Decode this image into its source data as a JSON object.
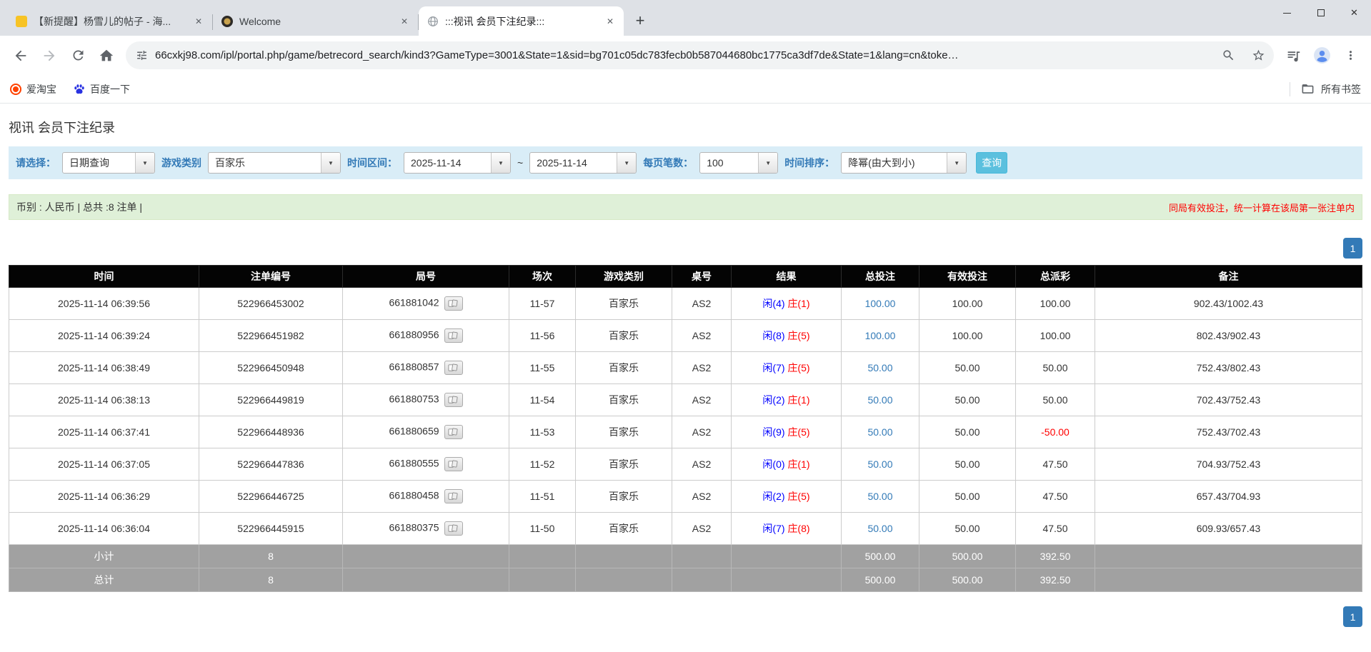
{
  "icons": {
    "dropdown_arrow": "▼",
    "close": "✕",
    "plus": "+"
  },
  "colors": {
    "player_blue": "#0000ff",
    "banker_red": "#ff0000",
    "bet_link_blue": "#337ab7",
    "search_button": "#5bc0de",
    "pagination_blue": "#337ab7",
    "filter_bar_bg": "#d9edf7",
    "summary_bar_bg": "#dff0d8",
    "table_header_bg": "#040404",
    "summary_row_bg": "#a1a1a1"
  },
  "browser": {
    "tabs": [
      {
        "title": "【新提醒】杨雪儿的帖子 - 海..."
      },
      {
        "title": "Welcome"
      },
      {
        "title": ":::视讯 会员下注纪录:::"
      }
    ],
    "url": "66cxkj98.com/ipl/portal.php/game/betrecord_search/kind3?GameType=3001&State=1&sid=bg701c05dc783fecb0b587044680bc1775ca3df7de&State=1&lang=cn&toke…",
    "bookmarks": {
      "items": [
        {
          "label": "爱淘宝"
        },
        {
          "label": "百度一下"
        }
      ],
      "all_bookmarks_label": "所有书签"
    }
  },
  "page": {
    "title": "视讯 会员下注纪录",
    "filter": {
      "select_label": "请选择：",
      "select_value": "日期查询",
      "game_type_label": "游戏类别",
      "game_type_value": "百家乐",
      "range_label": "时间区间：",
      "date_from": "2025-11-14",
      "range_separator": "~",
      "date_to": "2025-11-14",
      "page_size_label": "每页笔数：",
      "page_size_value": "100",
      "sort_label": "时间排序：",
      "sort_value": "降幂(由大到小)",
      "search_button_label": "查询"
    },
    "summary": {
      "currency_info": "币别 : 人民币 | 总共 :8 注单 |",
      "notice": "同局有效投注，统一计算在该局第一张注单内"
    },
    "pagination": {
      "page": "1"
    },
    "table": {
      "headers": [
        "时间",
        "注单编号",
        "局号",
        "场次",
        "游戏类别",
        "桌号",
        "结果",
        "总投注",
        "有效投注",
        "总派彩",
        "备注"
      ],
      "rows": [
        {
          "time": "2025-11-14 06:39:56",
          "bet_id": "522966453002",
          "round_no": "661881042",
          "session": "11-57",
          "game_type": "百家乐",
          "table_no": "AS2",
          "result_player": "闲(4)",
          "result_banker": "庄(1)",
          "total_bet": "100.00",
          "valid_bet": "100.00",
          "payout": "100.00",
          "payout_negative": false,
          "note": "902.43/1002.43"
        },
        {
          "time": "2025-11-14 06:39:24",
          "bet_id": "522966451982",
          "round_no": "661880956",
          "session": "11-56",
          "game_type": "百家乐",
          "table_no": "AS2",
          "result_player": "闲(8)",
          "result_banker": "庄(5)",
          "total_bet": "100.00",
          "valid_bet": "100.00",
          "payout": "100.00",
          "payout_negative": false,
          "note": "802.43/902.43"
        },
        {
          "time": "2025-11-14 06:38:49",
          "bet_id": "522966450948",
          "round_no": "661880857",
          "session": "11-55",
          "game_type": "百家乐",
          "table_no": "AS2",
          "result_player": "闲(7)",
          "result_banker": "庄(5)",
          "total_bet": "50.00",
          "valid_bet": "50.00",
          "payout": "50.00",
          "payout_negative": false,
          "note": "752.43/802.43"
        },
        {
          "time": "2025-11-14 06:38:13",
          "bet_id": "522966449819",
          "round_no": "661880753",
          "session": "11-54",
          "game_type": "百家乐",
          "table_no": "AS2",
          "result_player": "闲(2)",
          "result_banker": "庄(1)",
          "total_bet": "50.00",
          "valid_bet": "50.00",
          "payout": "50.00",
          "payout_negative": false,
          "note": "702.43/752.43"
        },
        {
          "time": "2025-11-14 06:37:41",
          "bet_id": "522966448936",
          "round_no": "661880659",
          "session": "11-53",
          "game_type": "百家乐",
          "table_no": "AS2",
          "result_player": "闲(9)",
          "result_banker": "庄(5)",
          "total_bet": "50.00",
          "valid_bet": "50.00",
          "payout": "-50.00",
          "payout_negative": true,
          "note": "752.43/702.43"
        },
        {
          "time": "2025-11-14 06:37:05",
          "bet_id": "522966447836",
          "round_no": "661880555",
          "session": "11-52",
          "game_type": "百家乐",
          "table_no": "AS2",
          "result_player": "闲(0)",
          "result_banker": "庄(1)",
          "total_bet": "50.00",
          "valid_bet": "50.00",
          "payout": "47.50",
          "payout_negative": false,
          "note": "704.93/752.43"
        },
        {
          "time": "2025-11-14 06:36:29",
          "bet_id": "522966446725",
          "round_no": "661880458",
          "session": "11-51",
          "game_type": "百家乐",
          "table_no": "AS2",
          "result_player": "闲(2)",
          "result_banker": "庄(5)",
          "total_bet": "50.00",
          "valid_bet": "50.00",
          "payout": "47.50",
          "payout_negative": false,
          "note": "657.43/704.93"
        },
        {
          "time": "2025-11-14 06:36:04",
          "bet_id": "522966445915",
          "round_no": "661880375",
          "session": "11-50",
          "game_type": "百家乐",
          "table_no": "AS2",
          "result_player": "闲(7)",
          "result_banker": "庄(8)",
          "total_bet": "50.00",
          "valid_bet": "50.00",
          "payout": "47.50",
          "payout_negative": false,
          "note": "609.93/657.43"
        }
      ],
      "footer_rows": [
        {
          "label": "小计",
          "count": "8",
          "total_bet": "500.00",
          "valid_bet": "500.00",
          "payout": "392.50"
        },
        {
          "label": "总计",
          "count": "8",
          "total_bet": "500.00",
          "valid_bet": "500.00",
          "payout": "392.50"
        }
      ]
    }
  }
}
